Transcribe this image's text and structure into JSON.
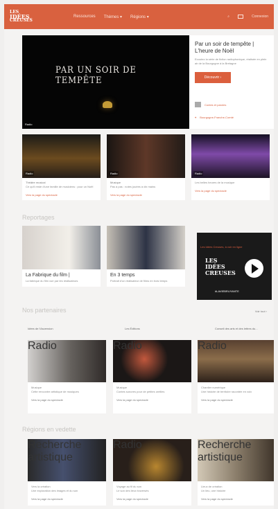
{
  "header": {
    "logo_line1": "LES",
    "logo_line2": "IDÉES",
    "logo_line3": "CREUSES",
    "nav": [
      "Ressources",
      "Thèmes ▾",
      "Régions ▾"
    ],
    "login": "Connexion"
  },
  "featured": {
    "video_title": "PAR UN SOIR DE TEMPÊTE",
    "badge": "Radio",
    "title": "Par un soir de tempête | L'heure de Noël",
    "desc": "Ecoutez la série de fiction radiophonique, réalisée en plein air de la Bourgogne à la Bretagne",
    "button": "Découvrir ›",
    "meta1": "Contes et paroles",
    "meta2": "Bourgogne-Franche-Comté"
  },
  "top_cards": [
    {
      "label": "Radio",
      "type": "Théâtre musical",
      "text": "Ce qu'il reste d'une famille de musiciens : pour un Noël",
      "link": "Vers la page du spectacle"
    },
    {
      "label": "Radio",
      "type": "Musique",
      "text": "Pas à pas : notes jouées à dix mains",
      "link": "Vers la page du spectacle"
    },
    {
      "label": "Radio",
      "type": "",
      "text": "Les belles heures de la musique",
      "link": "Vers la page du spectacle"
    }
  ],
  "section_reportages": "Reportages",
  "reportages": [
    {
      "title": "La Fabrique du film |",
      "text": "La fabrique du film vue par les réalisateurs"
    },
    {
      "title": "En 3 temps",
      "text": "Portrait d'un réalisateur de films en trois temps"
    }
  ],
  "promo": {
    "text": "Les Idées Creuses, à voir en ligne",
    "logo": "LES IDÉES CREUSES",
    "hashtag": "#LAVIEBRUYANTE"
  },
  "section_partners": "Nos partenaires",
  "see_all": "Voir tout ›",
  "partners": [
    {
      "name": "Idées de l'Ascension"
    },
    {
      "name": "Les Éditions"
    },
    {
      "name": "Conseil des arts et des lettres du..."
    }
  ],
  "partner_cards": [
    {
      "label": "Radio",
      "type": "Musique",
      "text": "Cette rencontre artistique de musiques",
      "link": "Vers la page du spectacle"
    },
    {
      "label": "Radio",
      "type": "Musique",
      "text": "Contes sonores pour de petites oreilles",
      "link": "Vers la page du spectacle"
    },
    {
      "label": "Radio",
      "type": "Chantier numérique",
      "text": "Une histoire de territoire racontée en voix",
      "link": "Vers la page du spectacle"
    }
  ],
  "section_regions": "Régions en vedette",
  "bottom_cards": [
    {
      "label": "Recherche artistique",
      "type": "Vers la création",
      "text": "Une exploration des images et du son",
      "link": "Vers la page du spectacle"
    },
    {
      "label": "Radio",
      "type": "Voyage au fil du son",
      "text": "Le son des lieux traversés",
      "link": "Vers la page du spectacle"
    },
    {
      "label": "Recherche artistique",
      "type": "Lieux de création",
      "text": "Un lieu, une histoire",
      "link": "Vers la page du spectacle"
    }
  ]
}
